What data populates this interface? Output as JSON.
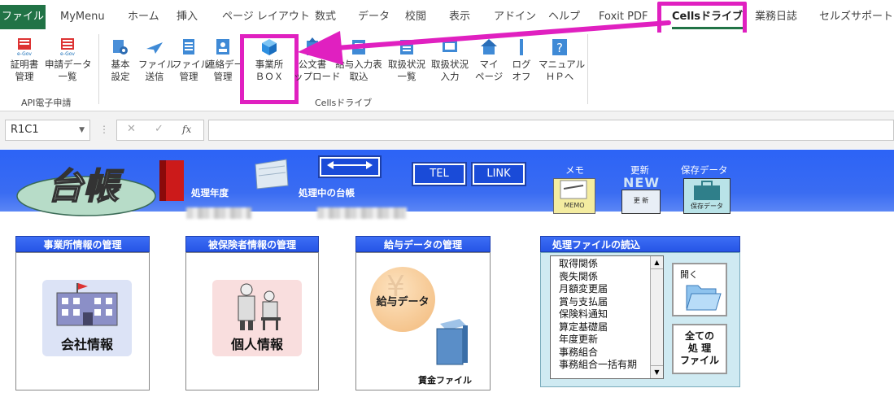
{
  "tabs": [
    "ファイル",
    "MyMenu",
    "ホーム",
    "挿入",
    "ページ レイアウト",
    "数式",
    "データ",
    "校閲",
    "表示",
    "アドイン",
    "ヘルプ",
    "Foxit PDF",
    "Cellsドライブ",
    "業務日誌",
    "セルズサポート"
  ],
  "ribbon": {
    "api_group": {
      "label": "API電子申請",
      "buttons": [
        {
          "l1": "証明書",
          "l2": "管理"
        },
        {
          "l1": "申請データ",
          "l2": "一覧"
        }
      ]
    },
    "cells_group": {
      "label": "Cellsドライブ",
      "buttons": [
        {
          "l1": "基本",
          "l2": "設定"
        },
        {
          "l1": "ファイル",
          "l2": "送信"
        },
        {
          "l1": "ファイル",
          "l2": "管理"
        },
        {
          "l1": "連絡デー",
          "l2": "管理"
        },
        {
          "l1": "事業所",
          "l2": "ＢＯＸ"
        },
        {
          "l1": "公文書",
          "l2": "ップロード"
        },
        {
          "l1": "給与入力表",
          "l2": "取込"
        },
        {
          "l1": "取扱状況",
          "l2": "一覧"
        },
        {
          "l1": "取扱状況",
          "l2": "入力"
        },
        {
          "l1": "マイ",
          "l2": "ページ"
        },
        {
          "l1": "ログ",
          "l2": "オフ"
        },
        {
          "l1": "マニュアル",
          "l2": "ＨＰへ"
        }
      ]
    },
    "egov_text": "e-Gov"
  },
  "formula_bar": {
    "name_box": "R1C1",
    "fx": "fx",
    "cancel": "✕",
    "enter": "✓",
    "value": ""
  },
  "banner": {
    "logo_text": "台帳",
    "processing_year_label": "処理年度",
    "processing_ledger_label": "処理中の台帳",
    "tel_label": "TEL",
    "link_label": "LINK",
    "memo_caption": "メモ",
    "memo_icon_text": "MEMO",
    "update_caption": "更新",
    "update_icon_text": "更 新",
    "new_text": "NEW",
    "save_caption": "保存データ",
    "save_icon_text": "保存データ"
  },
  "panels": {
    "company": {
      "title": "事業所情報の管理",
      "button": "会社情報"
    },
    "insured": {
      "title": "被保険者情報の管理",
      "button": "個人情報"
    },
    "salary": {
      "title": "給与データの管理",
      "circle": "給与データ",
      "ledger": "賃金ファイル"
    },
    "files": {
      "title": "処理ファイルの読込",
      "items": [
        "取得関係",
        "喪失関係",
        "月額変更届",
        "賞与支払届",
        "保険料通知",
        "算定基礎届",
        "年度更新",
        "事務組合",
        "事務組合一括有期"
      ],
      "open_label": "開く",
      "all_l1": "全ての",
      "all_l2": "処 理",
      "all_l3": "ファイル"
    }
  },
  "colors": {
    "accent_magenta": "#e020c0",
    "excel_green": "#217346",
    "banner_blue": "#2c63f6"
  }
}
